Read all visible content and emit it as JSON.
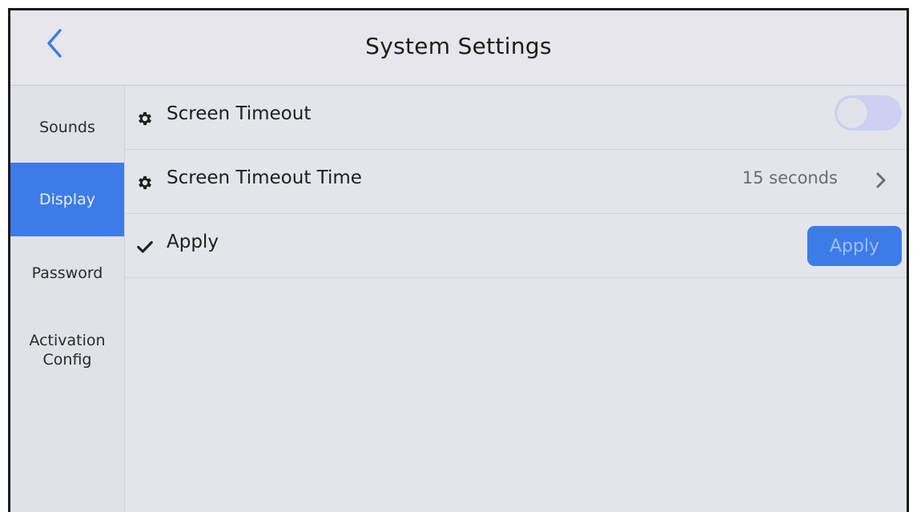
{
  "header": {
    "title": "System Settings",
    "back_icon": "chevron-left-icon"
  },
  "sidebar": {
    "items": [
      {
        "label": "Sounds",
        "active": false
      },
      {
        "label": "Display",
        "active": true
      },
      {
        "label": "Password",
        "active": false
      },
      {
        "label": "Activation\nConfig",
        "active": false
      }
    ]
  },
  "settings": {
    "screen_timeout": {
      "icon": "gear-icon",
      "label": "Screen Timeout",
      "toggle_on": false
    },
    "screen_timeout_time": {
      "icon": "gear-icon",
      "label": "Screen Timeout Time",
      "value": "15 seconds",
      "action_icon": "chevron-right-icon"
    },
    "apply": {
      "icon": "check-icon",
      "label": "Apply",
      "button_label": "Apply"
    }
  },
  "colors": {
    "accent": "#3d7ce8",
    "background": "#e4e5eb",
    "toggle_track": "#cdd0f2"
  }
}
